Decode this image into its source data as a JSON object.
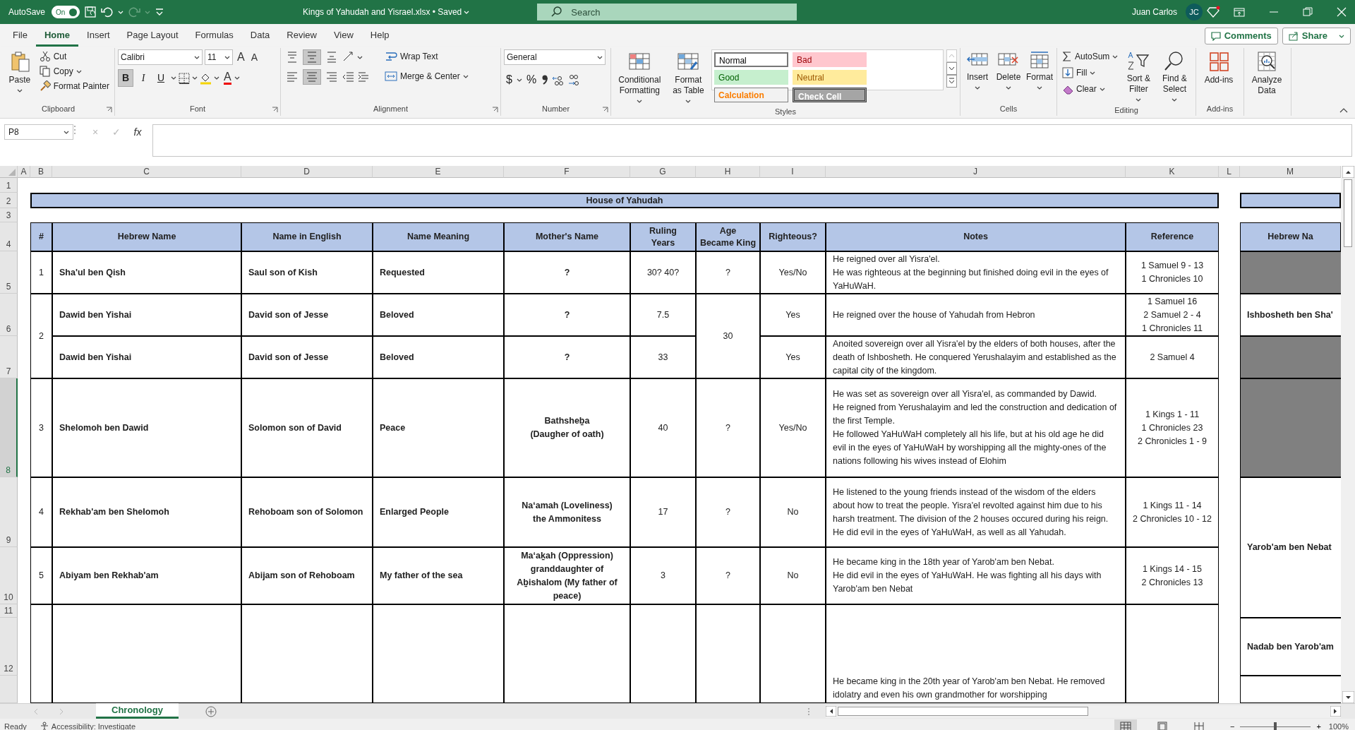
{
  "title_bar": {
    "autosave": {
      "label": "AutoSave",
      "on": true,
      "state_text": "On"
    },
    "redo": {
      "disabled": true
    },
    "file_title": "Kings of Yahudah and Yisrael.xlsx • Saved",
    "search_placeholder": "Search",
    "user_name": "Juan Carlos",
    "user_initials": "JC"
  },
  "ribbon": {
    "tabs": [
      {
        "label": "File",
        "selected": false
      },
      {
        "label": "Home",
        "selected": true
      },
      {
        "label": "Insert",
        "selected": false
      },
      {
        "label": "Page Layout",
        "selected": false
      },
      {
        "label": "Formulas",
        "selected": false
      },
      {
        "label": "Data",
        "selected": false
      },
      {
        "label": "Review",
        "selected": false
      },
      {
        "label": "View",
        "selected": false
      },
      {
        "label": "Help",
        "selected": false
      }
    ],
    "comments": "Comments",
    "share": "Share",
    "clipboard": {
      "label": "Clipboard",
      "paste": "Paste",
      "cut": "Cut",
      "copy": "Copy",
      "format_painter": "Format Painter"
    },
    "font": {
      "label": "Font",
      "font_name": "Calibri",
      "font_size": "11",
      "grow": "A",
      "shrink": "A",
      "styles": [
        {
          "label": "B",
          "kind": "bold",
          "selected": true
        },
        {
          "label": "I",
          "kind": "italic",
          "selected": false
        },
        {
          "label": "U",
          "kind": "underline",
          "selected": false
        }
      ],
      "font_color": "A"
    },
    "alignment": {
      "label": "Alignment",
      "vertical": [
        {
          "kind": "top",
          "selected": false
        },
        {
          "kind": "middle",
          "selected": true
        },
        {
          "kind": "bottom",
          "selected": false
        }
      ],
      "horizontal": [
        {
          "kind": "left",
          "selected": false
        },
        {
          "kind": "center",
          "selected": true
        },
        {
          "kind": "right",
          "selected": false
        }
      ],
      "wrap_text": "Wrap Text",
      "merge_center": "Merge & Center"
    },
    "number": {
      "label": "Number",
      "format": "General",
      "currency": "$",
      "percent": "%"
    },
    "styles": {
      "label": "Styles",
      "conditional": "Conditional Formatting",
      "format_table": "Format as Table",
      "gallery": [
        {
          "label": "Normal",
          "kind": "normal"
        },
        {
          "label": "Bad",
          "kind": "bad"
        },
        {
          "label": "Good",
          "kind": "good"
        },
        {
          "label": "Neutral",
          "kind": "neutral"
        },
        {
          "label": "Calculation",
          "kind": "calculation"
        },
        {
          "label": "Check Cell",
          "kind": "check"
        }
      ]
    },
    "cells": {
      "label": "Cells",
      "buttons": [
        {
          "label": "Insert",
          "kind": "insert"
        },
        {
          "label": "Delete",
          "kind": "delete"
        },
        {
          "label": "Format",
          "kind": "format"
        }
      ]
    },
    "editing": {
      "label": "Editing",
      "autosum": "AutoSum",
      "fill": "Fill",
      "clear": "Clear",
      "sort": "Sort & Filter",
      "find": "Find & Select"
    },
    "addins": {
      "label": "Add-ins",
      "button": "Add-ins"
    },
    "analyze": {
      "button": "Analyze Data"
    }
  },
  "formula_bar": {
    "name_box": "P8",
    "buttons": [
      {
        "label": "×",
        "disabled": true
      },
      {
        "label": "✓",
        "disabled": true
      },
      {
        "label": "fx",
        "disabled": false
      }
    ]
  },
  "sheet": {
    "columns": [
      "A",
      "B",
      "C",
      "D",
      "E",
      "F",
      "G",
      "H",
      "I",
      "J",
      "K",
      "L",
      "M"
    ],
    "rows": [
      {
        "label": "1",
        "selected": false
      },
      {
        "label": "2",
        "selected": false
      },
      {
        "label": "3",
        "selected": false
      },
      {
        "label": "4",
        "selected": false
      },
      {
        "label": "5",
        "selected": false
      },
      {
        "label": "6",
        "selected": false
      },
      {
        "label": "7",
        "selected": false
      },
      {
        "label": "8",
        "selected": true
      },
      {
        "label": "9",
        "selected": false
      },
      {
        "label": "10",
        "selected": false
      },
      {
        "label": "11",
        "selected": false
      },
      {
        "label": "12",
        "selected": false
      }
    ],
    "banner": "House of Yahudah",
    "headers": [
      "#",
      "Hebrew Name",
      "Name in English",
      "Name Meaning",
      "Mother's Name",
      "Ruling\nYears",
      "Age\nBecame King",
      "Righteous?",
      "Notes",
      "Reference"
    ],
    "kings": [
      {
        "number": "1",
        "age": "?",
        "periods": [
          {
            "hebrew": "Sha'ul ben Qish",
            "english": "Saul son of Kish",
            "meaning": "Requested",
            "mother": "?",
            "years": "30? 40?",
            "righteous": "Yes/No",
            "notes": "He reigned over all Yisra'el.\nHe was righteous at the beginning but finished doing evil in the eyes of YaHuWaH.",
            "reference": "1 Samuel 9 - 13\n1 Chronicles 10"
          }
        ]
      },
      {
        "number": "2",
        "age": "30",
        "periods": [
          {
            "hebrew": "Dawid ben Yishai",
            "english": "David son of Jesse",
            "meaning": "Beloved",
            "mother": "?",
            "years": "7.5",
            "righteous": "Yes",
            "notes": "He reigned over the house of Yahudah from Hebron",
            "reference": "1 Samuel 16\n2 Samuel 2 - 4\n1 Chronicles 11"
          },
          {
            "hebrew": "Dawid ben Yishai",
            "english": "David son of Jesse",
            "meaning": "Beloved",
            "mother": "?",
            "years": "33",
            "righteous": "Yes",
            "notes": "Anoited sovereign over all Yisra'el by the elders of both houses, after the death of Ishbosheth. He conquered Yerushalayim and established as the capital city of the kingdom.",
            "reference": "2 Samuel 4"
          }
        ]
      },
      {
        "number": "3",
        "age": "?",
        "periods": [
          {
            "hebrew": "Shelomoh ben Dawid",
            "english": "Solomon son of David",
            "meaning": "Peace",
            "mother": "Bathsheḇa\n(Daugher of oath)",
            "years": "40",
            "righteous": "Yes/No",
            "notes": "He was set as sovereign over all Yisra'el, as commanded by Dawid.\nHe reigned from Yerushalayim and led the construction and dedication of the first Temple.\nHe followed YaHuWaH completely all his life, but at his old age he did evil in the eyes of YaHuWaH by worshipping all the mighty-ones of the nations following his wives instead of Elohim",
            "reference": "1 Kings 1 - 11\n1 Chronicles 23\n2 Chronicles 1 - 9"
          }
        ]
      },
      {
        "number": "4",
        "age": "?",
        "periods": [
          {
            "hebrew": "Rekhab'am ben Shelomoh",
            "english": "Rehoboam son of Solomon",
            "meaning": "Enlarged People",
            "mother": "Na‘amah (Loveliness)\nthe Ammonitess",
            "years": "17",
            "righteous": "No",
            "notes": "He listened to the young friends instead of the wisdom of the elders about how to treat the people. Yisra'el revolted against him due to his harsh treatment. The division of the 2 houses occured during his reign.\nHe did evil in the eyes of YaHuWaH, as well as all Yahudah.",
            "reference": "1 Kings 11 - 14\n2 Chronicles 10 - 12"
          }
        ]
      },
      {
        "number": "5",
        "age": "?",
        "periods": [
          {
            "hebrew": "Abiyam ben Rekhab'am",
            "english": "Abijam son of Rehoboam",
            "meaning": "My father of the sea",
            "mother": "Ma‘aḵah (Oppression) granddaughter of Aḇishalom (My father of peace)",
            "years": "3",
            "righteous": "No",
            "notes": "He became king in the 18th year of Yarob'am ben Nebat.\nHe did evil in the eyes of YaHuWaH. He was fighting all his days with Yarob'am ben Nebat",
            "reference": "1 Kings 14 - 15\n2 Chronicles 13"
          }
        ]
      }
    ],
    "partial_notes": "He became king in the 20th year of Yarob'am ben Nebat. He removed idolatry and even his own grandmother for worshipping",
    "side_header": "Hebrew Na",
    "side_cells": [
      {
        "kind": "shaded"
      },
      {
        "kind": "name",
        "text": "Ishbosheth ben Sha'"
      },
      {
        "kind": "shaded"
      },
      {
        "kind": "shaded"
      },
      {
        "kind": "name",
        "text": "Yarob'am ben Nebat"
      },
      {
        "kind": "name",
        "text": "Nadab ben Yarob'am"
      },
      {
        "kind": "blank"
      }
    ]
  },
  "sheet_tabs": [
    {
      "label": "Chronology",
      "selected": true
    }
  ],
  "status_bar": {
    "status": "Ready",
    "accessibility": "Accessibility: Investigate",
    "views": [
      {
        "kind": "normal",
        "selected": true
      },
      {
        "kind": "page_layout",
        "selected": false
      },
      {
        "kind": "page_break",
        "selected": false
      }
    ],
    "zoom_out": "−",
    "zoom_in": "+",
    "zoom": {
      "level": 0.5,
      "reading": "100%"
    }
  }
}
